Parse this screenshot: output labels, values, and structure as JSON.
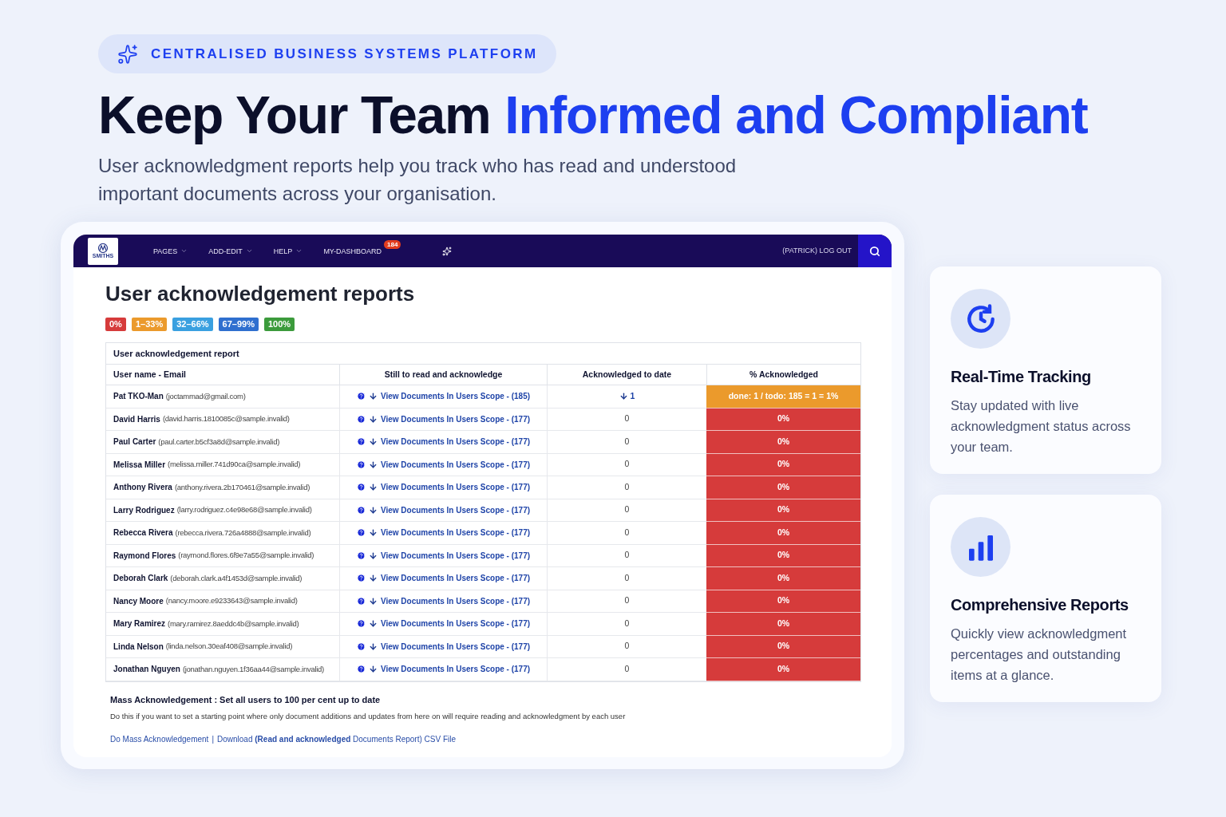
{
  "eyebrow": "CENTRALISED BUSINESS SYSTEMS PLATFORM",
  "headline": [
    {
      "text": "Keep Your Team",
      "accent": false
    },
    {
      "text": "Informed and Compliant",
      "accent": true
    }
  ],
  "subtitle": "User acknowledgment reports help you track who has read and understood important documents across your organisation.",
  "app": {
    "logo_text": "SMITHS",
    "nav": [
      {
        "label": "PAGES",
        "dropdown": true
      },
      {
        "label": "ADD-EDIT",
        "dropdown": true
      },
      {
        "label": "HELP",
        "dropdown": true
      },
      {
        "label": "MY-DASHBOARD",
        "dropdown": false,
        "badge": "184"
      }
    ],
    "logout": "(PATRICK) LOG OUT",
    "title": "User acknowledgement reports",
    "legend": [
      {
        "label": "0%",
        "color": "#d63b3b"
      },
      {
        "label": "1–33%",
        "color": "#eb9a2c"
      },
      {
        "label": "32–66%",
        "color": "#3aa0e0"
      },
      {
        "label": "67–99%",
        "color": "#2f6fcf"
      },
      {
        "label": "100%",
        "color": "#3c9b3c"
      }
    ],
    "table": {
      "caption": "User acknowledgement report",
      "columns": [
        "User name - Email",
        "Still to read and acknowledge",
        "Acknowledged to date",
        "% Acknowledged"
      ],
      "rows": [
        {
          "name": "Pat TKO-Man",
          "email": "(joctammad@gmail.com)",
          "link": "View Documents In Users Scope - (185)",
          "acknowledged": "1",
          "kind": "link",
          "percent": "done: 1 / todo: 185 = 1 = 1%",
          "color": "#eb9a2c"
        },
        {
          "name": "David Harris",
          "email": "(david.harris.1810085c@sample.invalid)",
          "link": "View Documents In Users Scope - (177)",
          "acknowledged": "0",
          "kind": "plain",
          "percent": "0%",
          "color": "#d63b3b"
        },
        {
          "name": "Paul Carter",
          "email": "(paul.carter.b5cf3a8d@sample.invalid)",
          "link": "View Documents In Users Scope - (177)",
          "acknowledged": "0",
          "kind": "plain",
          "percent": "0%",
          "color": "#d63b3b"
        },
        {
          "name": "Melissa Miller",
          "email": "(melissa.miller.741d90ca@sample.invalid)",
          "link": "View Documents In Users Scope - (177)",
          "acknowledged": "0",
          "kind": "plain",
          "percent": "0%",
          "color": "#d63b3b"
        },
        {
          "name": "Anthony Rivera",
          "email": "(anthony.rivera.2b170461@sample.invalid)",
          "link": "View Documents In Users Scope - (177)",
          "acknowledged": "0",
          "kind": "plain",
          "percent": "0%",
          "color": "#d63b3b"
        },
        {
          "name": "Larry Rodriguez",
          "email": "(larry.rodriguez.c4e98e68@sample.invalid)",
          "link": "View Documents In Users Scope - (177)",
          "acknowledged": "0",
          "kind": "plain",
          "percent": "0%",
          "color": "#d63b3b"
        },
        {
          "name": "Rebecca Rivera",
          "email": "(rebecca.rivera.726a4888@sample.invalid)",
          "link": "View Documents In Users Scope - (177)",
          "acknowledged": "0",
          "kind": "plain",
          "percent": "0%",
          "color": "#d63b3b"
        },
        {
          "name": "Raymond Flores",
          "email": "(raymond.flores.6f9e7a55@sample.invalid)",
          "link": "View Documents In Users Scope - (177)",
          "acknowledged": "0",
          "kind": "plain",
          "percent": "0%",
          "color": "#d63b3b"
        },
        {
          "name": "Deborah Clark",
          "email": "(deborah.clark.a4f1453d@sample.invalid)",
          "link": "View Documents In Users Scope - (177)",
          "acknowledged": "0",
          "kind": "plain",
          "percent": "0%",
          "color": "#d63b3b"
        },
        {
          "name": "Nancy Moore",
          "email": "(nancy.moore.e9233643@sample.invalid)",
          "link": "View Documents In Users Scope - (177)",
          "acknowledged": "0",
          "kind": "plain",
          "percent": "0%",
          "color": "#d63b3b"
        },
        {
          "name": "Mary Ramirez",
          "email": "(mary.ramirez.8aeddc4b@sample.invalid)",
          "link": "View Documents In Users Scope - (177)",
          "acknowledged": "0",
          "kind": "plain",
          "percent": "0%",
          "color": "#d63b3b"
        },
        {
          "name": "Linda Nelson",
          "email": "(linda.nelson.30eaf408@sample.invalid)",
          "link": "View Documents In Users Scope - (177)",
          "acknowledged": "0",
          "kind": "plain",
          "percent": "0%",
          "color": "#d63b3b"
        },
        {
          "name": "Jonathan Nguyen",
          "email": "(jonathan.nguyen.1f36aa44@sample.invalid)",
          "link": "View Documents In Users Scope - (177)",
          "acknowledged": "0",
          "kind": "plain",
          "percent": "0%",
          "color": "#d63b3b"
        }
      ]
    },
    "mass_title": "Mass Acknowledgement : Set all users to 100 per cent up to date",
    "mass_text": "Do this if you want to set a starting point where only document additions and updates from here on will require reading and acknowledgment by each user",
    "links": [
      "Do Mass Acknowledgement",
      "Download **(Read and acknowledged** Documents Report) CSV File"
    ],
    "link_separator": "|"
  },
  "features": [
    {
      "kind": "clock",
      "title": "Real-Time Tracking",
      "text": "Stay updated with live acknowledgment status across your team."
    },
    {
      "kind": "chart",
      "title": "Comprehensive Reports",
      "text": "Quickly view acknowledgment percentages and outstanding items at a glance."
    }
  ]
}
